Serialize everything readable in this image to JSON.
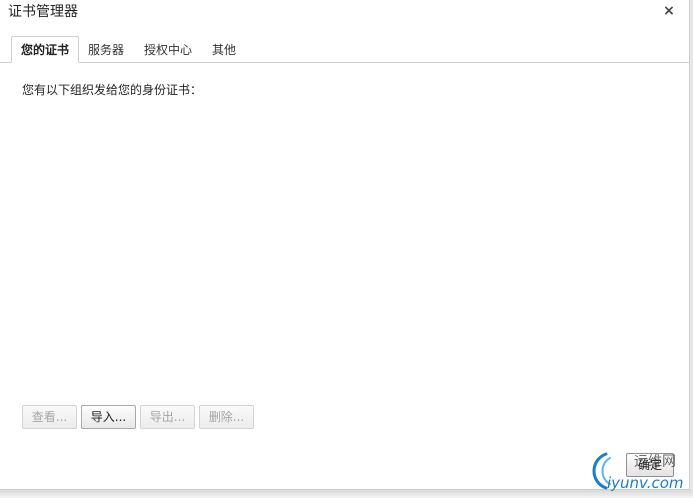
{
  "window": {
    "title": "证书管理器",
    "close_label": "×"
  },
  "tabs": [
    {
      "label": "您的证书",
      "active": true
    },
    {
      "label": "服务器",
      "active": false
    },
    {
      "label": "授权中心",
      "active": false
    },
    {
      "label": "其他",
      "active": false
    }
  ],
  "content": {
    "description": "您有以下组织发给您的身份证书："
  },
  "actions": {
    "view": {
      "label": "查看...",
      "enabled": false
    },
    "import": {
      "label": "导入...",
      "enabled": true
    },
    "export": {
      "label": "导出...",
      "enabled": false
    },
    "delete": {
      "label": "删除...",
      "enabled": false
    }
  },
  "footer": {
    "ok_label": "确定"
  },
  "watermark": {
    "top_text": "运维网",
    "bottom_text": "iyunv.com",
    "color": "#1a7fc4"
  }
}
